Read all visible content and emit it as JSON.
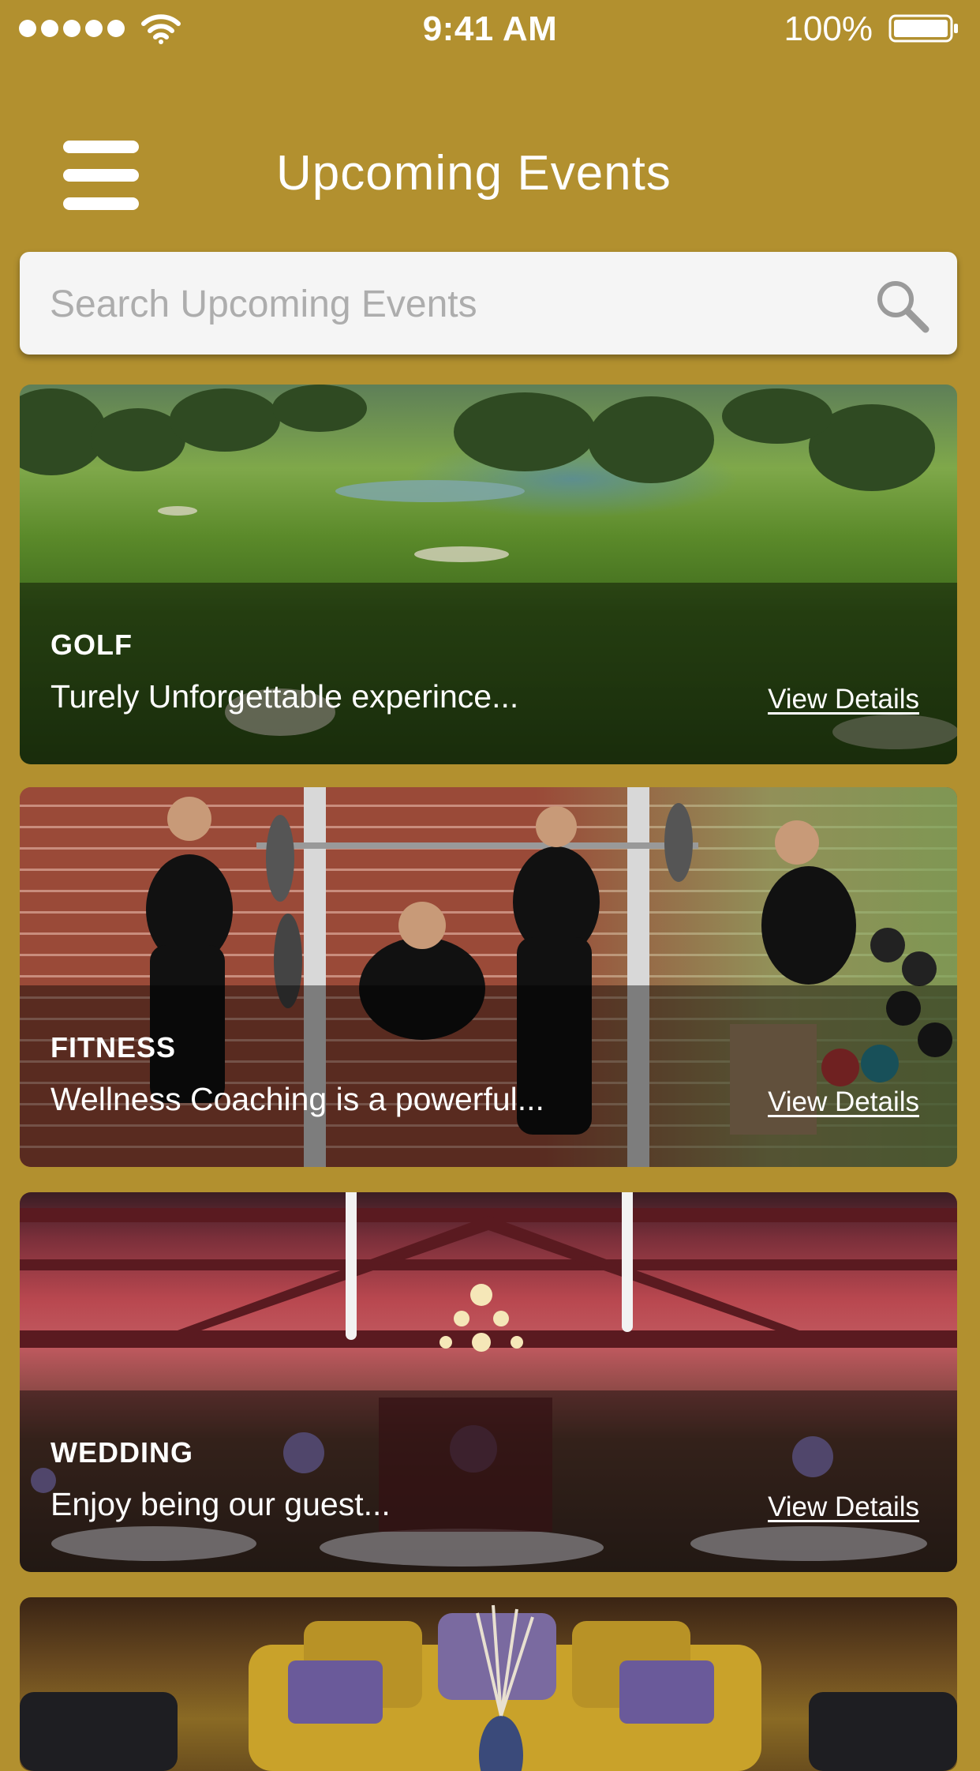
{
  "status_bar": {
    "time": "9:41 AM",
    "battery": "100%",
    "icons": [
      "signal-dots-icon",
      "wifi-icon",
      "battery-icon"
    ]
  },
  "header": {
    "title": "Upcoming Events",
    "menu_icon": "hamburger-menu-icon"
  },
  "search": {
    "placeholder": "Search Upcoming Events",
    "value": "",
    "icon": "search-icon"
  },
  "events": [
    {
      "category": "GOLF",
      "description": "Turely Unforgettable experince...",
      "link": "View Details"
    },
    {
      "category": "FITNESS",
      "description": "Wellness Coaching is a powerful...",
      "link": "View Details"
    },
    {
      "category": "WEDDING",
      "description": "Enjoy being our guest...",
      "link": "View Details"
    }
  ],
  "colors": {
    "background": "#B2902F",
    "search_background": "#F5F5F5",
    "placeholder": "#ADADAD",
    "text": "#FFFFFF"
  }
}
